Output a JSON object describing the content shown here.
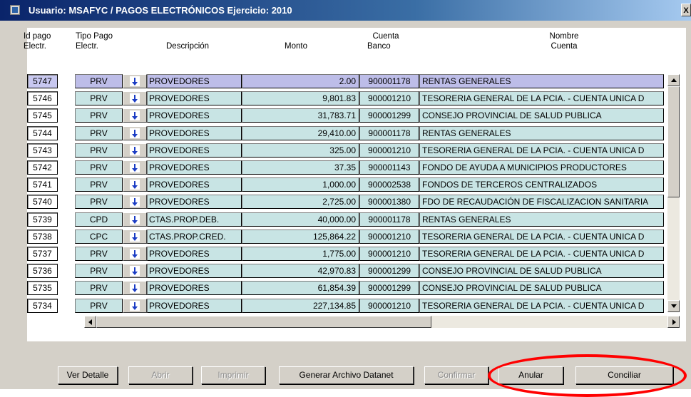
{
  "window": {
    "title": "Usuario: MSAFYC  /  PAGOS ELECTRÓNICOS  Ejercicio: 2010",
    "close_symbol": "X"
  },
  "headers": {
    "id_line1": "Id pago",
    "id_line2": "Electr.",
    "tipo_line1": "Tipo Pago",
    "tipo_line2": "Electr.",
    "descripcion": "Descripción",
    "monto": "Monto",
    "cuenta_line1": "Cuenta",
    "cuenta_line2": "Banco",
    "nombre_line1": "Nombre",
    "nombre_line2": "Cuenta"
  },
  "rows": [
    {
      "id": "5747",
      "tipo": "PRV",
      "desc": "PROVEDORES",
      "monto": "2.00",
      "cuenta": "900001178",
      "nombre": "RENTAS GENERALES"
    },
    {
      "id": "5746",
      "tipo": "PRV",
      "desc": "PROVEDORES",
      "monto": "9,801.83",
      "cuenta": "900001210",
      "nombre": "TESORERIA GENERAL DE LA PCIA. - CUENTA UNICA D"
    },
    {
      "id": "5745",
      "tipo": "PRV",
      "desc": "PROVEDORES",
      "monto": "31,783.71",
      "cuenta": "900001299",
      "nombre": "CONSEJO PROVINCIAL DE SALUD PUBLICA"
    },
    {
      "id": "5744",
      "tipo": "PRV",
      "desc": "PROVEDORES",
      "monto": "29,410.00",
      "cuenta": "900001178",
      "nombre": "RENTAS GENERALES"
    },
    {
      "id": "5743",
      "tipo": "PRV",
      "desc": "PROVEDORES",
      "monto": "325.00",
      "cuenta": "900001210",
      "nombre": "TESORERIA GENERAL DE LA PCIA. - CUENTA UNICA D"
    },
    {
      "id": "5742",
      "tipo": "PRV",
      "desc": "PROVEDORES",
      "monto": "37.35",
      "cuenta": "900001143",
      "nombre": "FONDO DE AYUDA A MUNICIPIOS PRODUCTORES"
    },
    {
      "id": "5741",
      "tipo": "PRV",
      "desc": "PROVEDORES",
      "monto": "1,000.00",
      "cuenta": "900002538",
      "nombre": "FONDOS DE TERCEROS CENTRALIZADOS"
    },
    {
      "id": "5740",
      "tipo": "PRV",
      "desc": "PROVEDORES",
      "monto": "2,725.00",
      "cuenta": "900001380",
      "nombre": "FDO DE RECAUDACIÓN DE FISCALIZACION SANITARIA"
    },
    {
      "id": "5739",
      "tipo": "CPD",
      "desc": "CTAS.PROP.DEB.",
      "monto": "40,000.00",
      "cuenta": "900001178",
      "nombre": "RENTAS GENERALES"
    },
    {
      "id": "5738",
      "tipo": "CPC",
      "desc": "CTAS.PROP.CRED.",
      "monto": "125,864.22",
      "cuenta": "900001210",
      "nombre": "TESORERIA GENERAL DE LA PCIA. - CUENTA UNICA D"
    },
    {
      "id": "5737",
      "tipo": "PRV",
      "desc": "PROVEDORES",
      "monto": "1,775.00",
      "cuenta": "900001210",
      "nombre": "TESORERIA GENERAL DE LA PCIA. - CUENTA UNICA D"
    },
    {
      "id": "5736",
      "tipo": "PRV",
      "desc": "PROVEDORES",
      "monto": "42,970.83",
      "cuenta": "900001299",
      "nombre": "CONSEJO PROVINCIAL DE SALUD PUBLICA"
    },
    {
      "id": "5735",
      "tipo": "PRV",
      "desc": "PROVEDORES",
      "monto": "61,854.39",
      "cuenta": "900001299",
      "nombre": "CONSEJO PROVINCIAL DE SALUD PUBLICA"
    },
    {
      "id": "5734",
      "tipo": "PRV",
      "desc": "PROVEDORES",
      "monto": "227,134.85",
      "cuenta": "900001210",
      "nombre": "TESORERIA GENERAL DE LA PCIA. - CUENTA UNICA D"
    }
  ],
  "buttons": {
    "ver_detalle": "Ver Detalle",
    "abrir": "Abrir",
    "imprimir": "Imprimir",
    "generar": "Generar Archivo Datanet",
    "confirmar": "Confirmar",
    "anular": "Anular",
    "conciliar": "Conciliar"
  },
  "icons": {
    "row_button": "down-arrow-icon",
    "window": "app-icon"
  },
  "colors": {
    "row_bg": "#c8e4e4",
    "selected_row_bg": "#bdbde8",
    "annotation_oval": "#ff0000"
  }
}
